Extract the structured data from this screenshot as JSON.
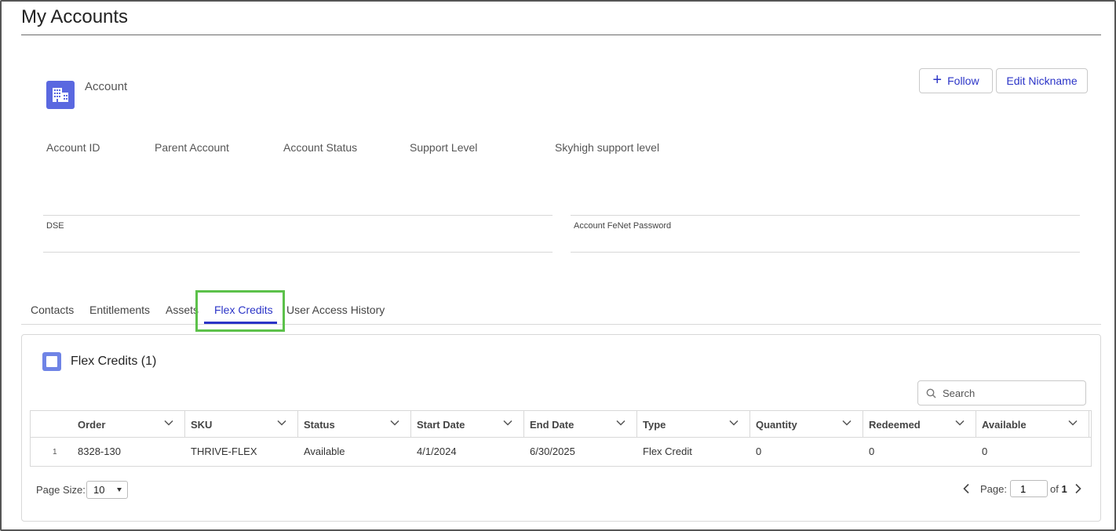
{
  "page": {
    "title": "My Accounts"
  },
  "account": {
    "type_label": "Account",
    "follow_label": "Follow",
    "edit_nickname_label": "Edit Nickname",
    "fields": [
      "Account ID",
      "Parent Account",
      "Account Status",
      "Support Level",
      "Skyhigh support level"
    ],
    "dse_label": "DSE",
    "fenet_label": "Account FeNet Password"
  },
  "tabs": [
    "Contacts",
    "Entitlements",
    "Assets",
    "Flex Credits",
    "User Access History"
  ],
  "active_tab": "Flex Credits",
  "flex": {
    "title": "Flex Credits (1)",
    "search_placeholder": "Search",
    "columns": [
      "Order",
      "SKU",
      "Status",
      "Start Date",
      "End Date",
      "Type",
      "Quantity",
      "Redeemed",
      "Available"
    ],
    "rows": [
      {
        "num": "1",
        "cells": [
          "8328-130",
          "THRIVE-FLEX",
          "Available",
          "4/1/2024",
          "6/30/2025",
          "Flex Credit",
          "0",
          "0",
          "0"
        ]
      }
    ],
    "page_size_label": "Page Size:",
    "page_size": "10",
    "page_label": "Page:",
    "page_value": "1",
    "page_of": "of",
    "page_total": "1"
  },
  "colors": {
    "accent": "#2b34c7",
    "icon_bg": "#5a68e0",
    "highlight": "#5cc14a"
  }
}
